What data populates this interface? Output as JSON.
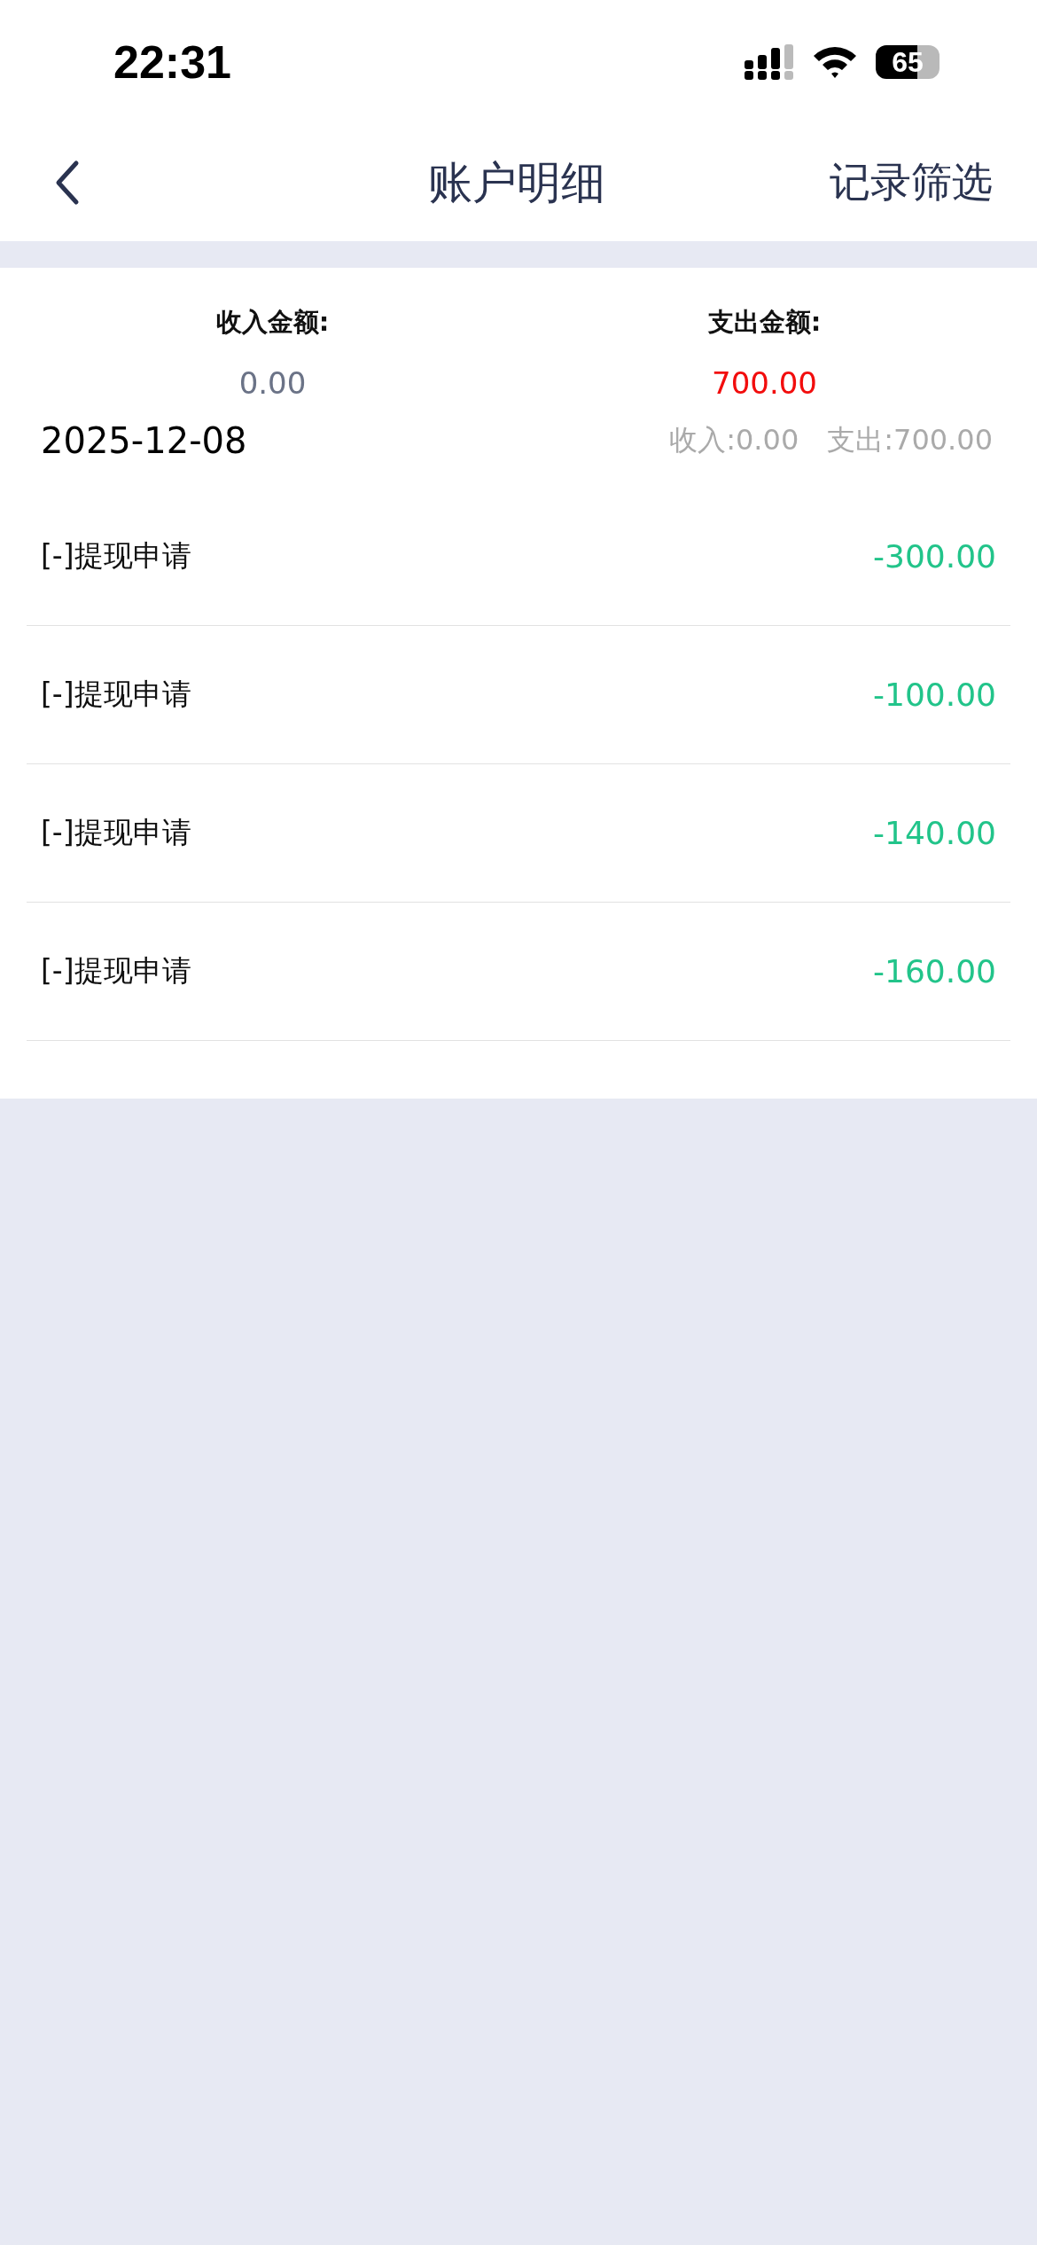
{
  "status_bar": {
    "time": "22:31",
    "battery": "65"
  },
  "nav": {
    "title": "账户明细",
    "action": "记录筛选"
  },
  "summary": [
    {
      "label": "收入金额:",
      "value": "0.00",
      "kind": "income"
    },
    {
      "label": "支出金额:",
      "value": "700.00",
      "kind": "expense"
    }
  ],
  "groups": [
    {
      "date": "2025-12-08",
      "income": "收入:0.00",
      "expense": "支出:700.00",
      "rows": [
        {
          "label": "[-]提现申请",
          "amount": "-300.00"
        },
        {
          "label": "[-]提现申请",
          "amount": "-100.00"
        },
        {
          "label": "[-]提现申请",
          "amount": "-140.00"
        },
        {
          "label": "[-]提现申请",
          "amount": "-160.00"
        }
      ]
    }
  ]
}
